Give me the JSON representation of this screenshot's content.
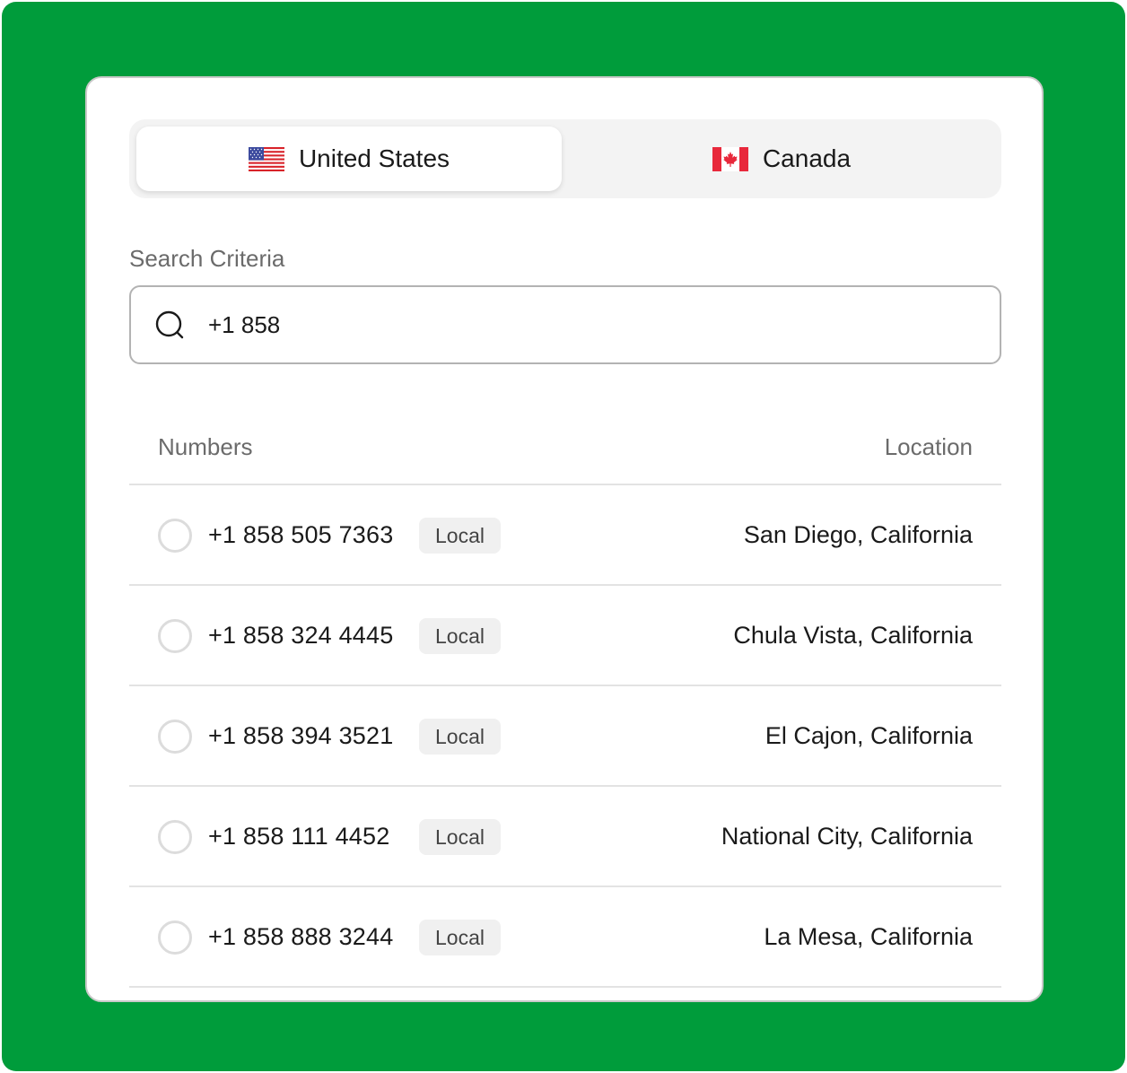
{
  "colors": {
    "background": "#009c3b",
    "card": "#ffffff",
    "toggle_bg": "#f3f3f3",
    "muted_text": "#6b6b6b",
    "badge_bg": "#f0f0f0"
  },
  "country_toggle": {
    "selected": "United States",
    "tabs": [
      {
        "label": "United States",
        "icon": "us-flag-icon"
      },
      {
        "label": "Canada",
        "icon": "canada-flag-icon"
      }
    ]
  },
  "search": {
    "label": "Search Criteria",
    "icon": "search-icon",
    "value": "+1 858"
  },
  "table": {
    "headers": {
      "numbers": "Numbers",
      "location": "Location"
    },
    "rows": [
      {
        "number": "+1 858 505 7363",
        "type": "Local",
        "location": "San Diego, California",
        "selected": false
      },
      {
        "number": "+1 858 324 4445",
        "type": "Local",
        "location": "Chula Vista, California",
        "selected": false
      },
      {
        "number": "+1 858 394 3521",
        "type": "Local",
        "location": "El Cajon, California",
        "selected": false
      },
      {
        "number": "+1 858 111 4452",
        "type": "Local",
        "location": "National City, California",
        "selected": false
      },
      {
        "number": "+1 858 888 3244",
        "type": "Local",
        "location": "La Mesa, California",
        "selected": false
      }
    ]
  }
}
